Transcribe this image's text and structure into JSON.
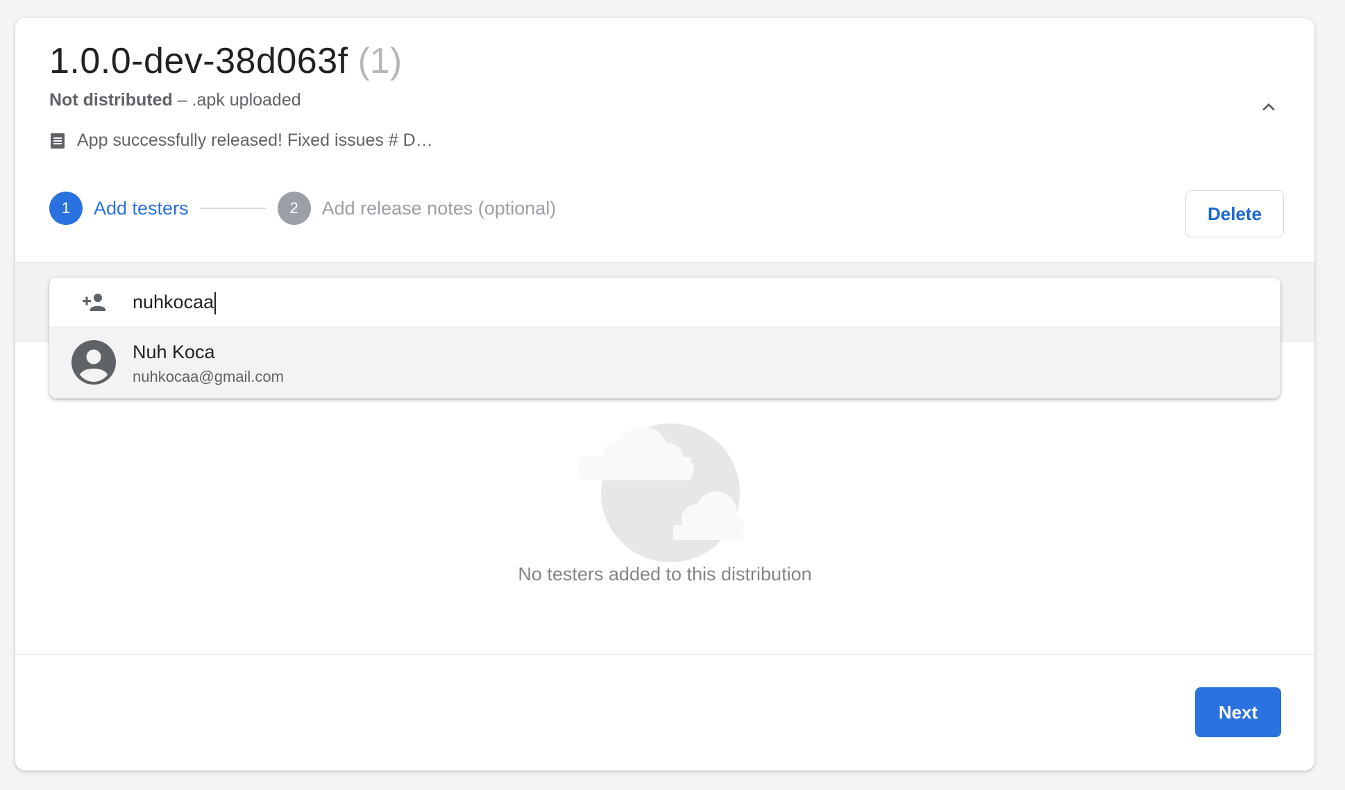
{
  "release": {
    "version": "1.0.0-dev-38d063f",
    "count": "(1)",
    "status_bold": "Not distributed",
    "status_rest": " – .apk uploaded",
    "notes_preview": "App successfully released! Fixed issues # D…"
  },
  "stepper": {
    "steps": [
      {
        "number": "1",
        "label": "Add testers",
        "state": "active"
      },
      {
        "number": "2",
        "label": "Add release notes (optional)",
        "state": "inactive"
      }
    ]
  },
  "actions": {
    "delete_label": "Delete",
    "next_label": "Next"
  },
  "tester_search": {
    "value": "nuhkocaa",
    "suggestions": [
      {
        "name": "Nuh Koca",
        "email": "nuhkocaa@gmail.com"
      }
    ]
  },
  "empty_state": {
    "message": "No testers added to this distribution"
  },
  "icons": {
    "collapse": "chevron-up-icon",
    "notes": "notes-icon",
    "add_person": "person-add-icon",
    "avatar": "account-circle-icon"
  },
  "colors": {
    "accent": "#2a72e0",
    "inactive_step": "#9aa0a6",
    "background": "#f4f5f7"
  }
}
